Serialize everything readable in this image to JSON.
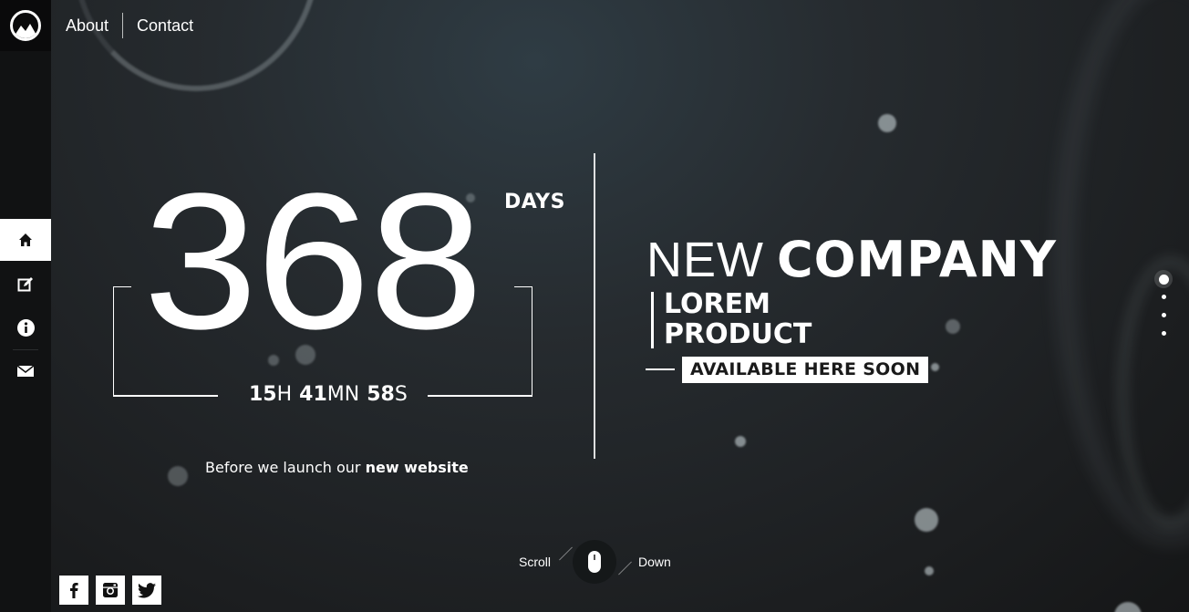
{
  "topnav": {
    "about": "About",
    "contact": "Contact"
  },
  "sidebar": {
    "items": [
      {
        "icon": "home-icon",
        "active": true
      },
      {
        "icon": "edit-icon",
        "active": false
      },
      {
        "icon": "info-icon",
        "active": false
      },
      {
        "icon": "mail-icon",
        "active": false
      }
    ]
  },
  "countdown": {
    "days": "368",
    "days_label": "DAYS",
    "hours": "15",
    "hours_unit": "H",
    "minutes": "41",
    "minutes_unit": "MN",
    "seconds": "58",
    "seconds_unit": "S"
  },
  "tagline": {
    "prefix": "Before we launch our",
    "highlight": "new website"
  },
  "headline": {
    "light": "NEW",
    "bold": "COMPANY"
  },
  "product": {
    "line1": "LOREM",
    "line2": "PRODUCT"
  },
  "availability": "AVAILABLE HERE SOON",
  "scroll": {
    "left": "Scroll",
    "right": "Down"
  },
  "pager": {
    "count": 4,
    "active_index": 0
  },
  "social": [
    "facebook-icon",
    "instagram-icon",
    "twitter-icon"
  ],
  "colors": {
    "background": "#1e2124",
    "accent": "#ffffff",
    "sidebar": "#111213"
  }
}
